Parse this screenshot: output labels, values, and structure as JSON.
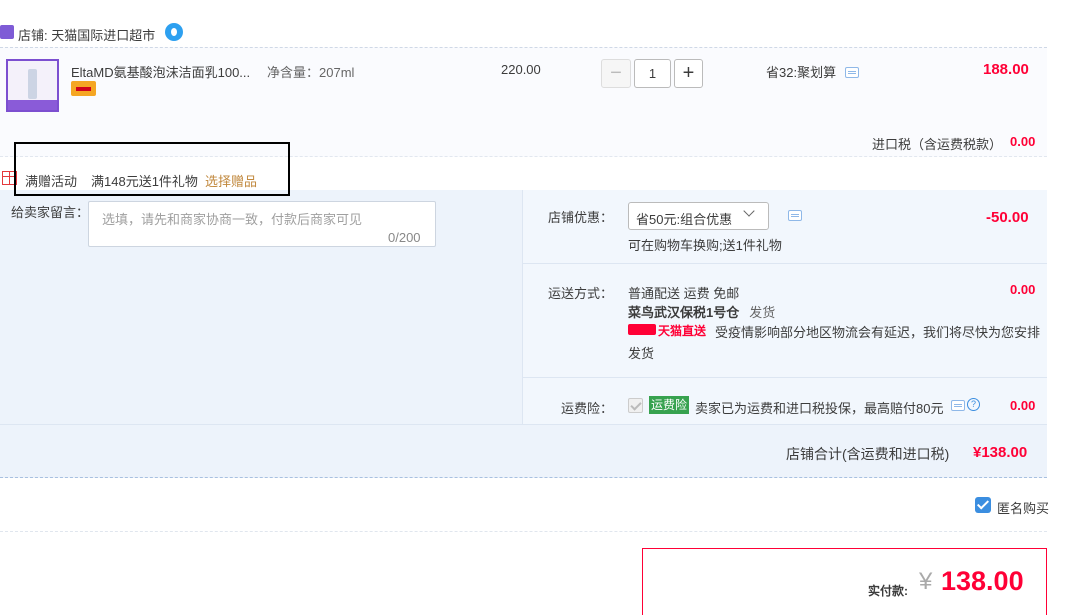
{
  "shop": {
    "label": "店铺: 天猫国际进口超市",
    "icon": "shop-icon",
    "chat_icon": "wangwang-icon"
  },
  "product": {
    "title": "EltaMD氨基酸泡沫洁面乳100...",
    "spec": "净含量：207ml",
    "unit_price": "220.00",
    "quantity": "1",
    "minus_label": "−",
    "plus_label": "+",
    "discount": "省32:聚划算",
    "line_total": "188.00",
    "tax_label": "进口税（含运费税款）",
    "tax_value": "0.00"
  },
  "gift": {
    "label": "满赠活动",
    "text": "满148元送1件礼物",
    "link": "选择赠品"
  },
  "message": {
    "label": "给卖家留言：",
    "placeholder": "选填，请先和商家协商一致，付款后商家可见",
    "count": "0/200"
  },
  "coupon": {
    "label": "店铺优惠：",
    "selected": "省50元:组合优惠",
    "note": "可在购物车换购;送1件礼物",
    "value": "-50.00"
  },
  "shipping": {
    "label": "运送方式：",
    "line1": "普通配送 运费 免邮",
    "warehouse": "菜鸟武汉保税1号仓",
    "warehouse_note": "发货",
    "logo_text": "天猫直送",
    "notice": "受疫情影响部分地区物流会有延迟，我们将尽快为您安排",
    "notice2": "发货",
    "value": "0.00"
  },
  "insurance": {
    "label": "运费险：",
    "badge": "运费险",
    "text": "卖家已为运费和进口税投保，最高赔付80元",
    "help": "?",
    "value": "0.00"
  },
  "shop_total": {
    "label": "店铺合计(含运费和进口税)",
    "value": "¥138.00"
  },
  "anonymous": {
    "label": "匿名购买",
    "checked": true
  },
  "payment": {
    "label": "实付款:",
    "currency": "¥",
    "amount": "138.00"
  },
  "colors": {
    "price_red": "#ff0036",
    "panel_blue": "#edf3fb",
    "link_gold": "#c1883d",
    "check_blue": "#3b8ee0"
  }
}
